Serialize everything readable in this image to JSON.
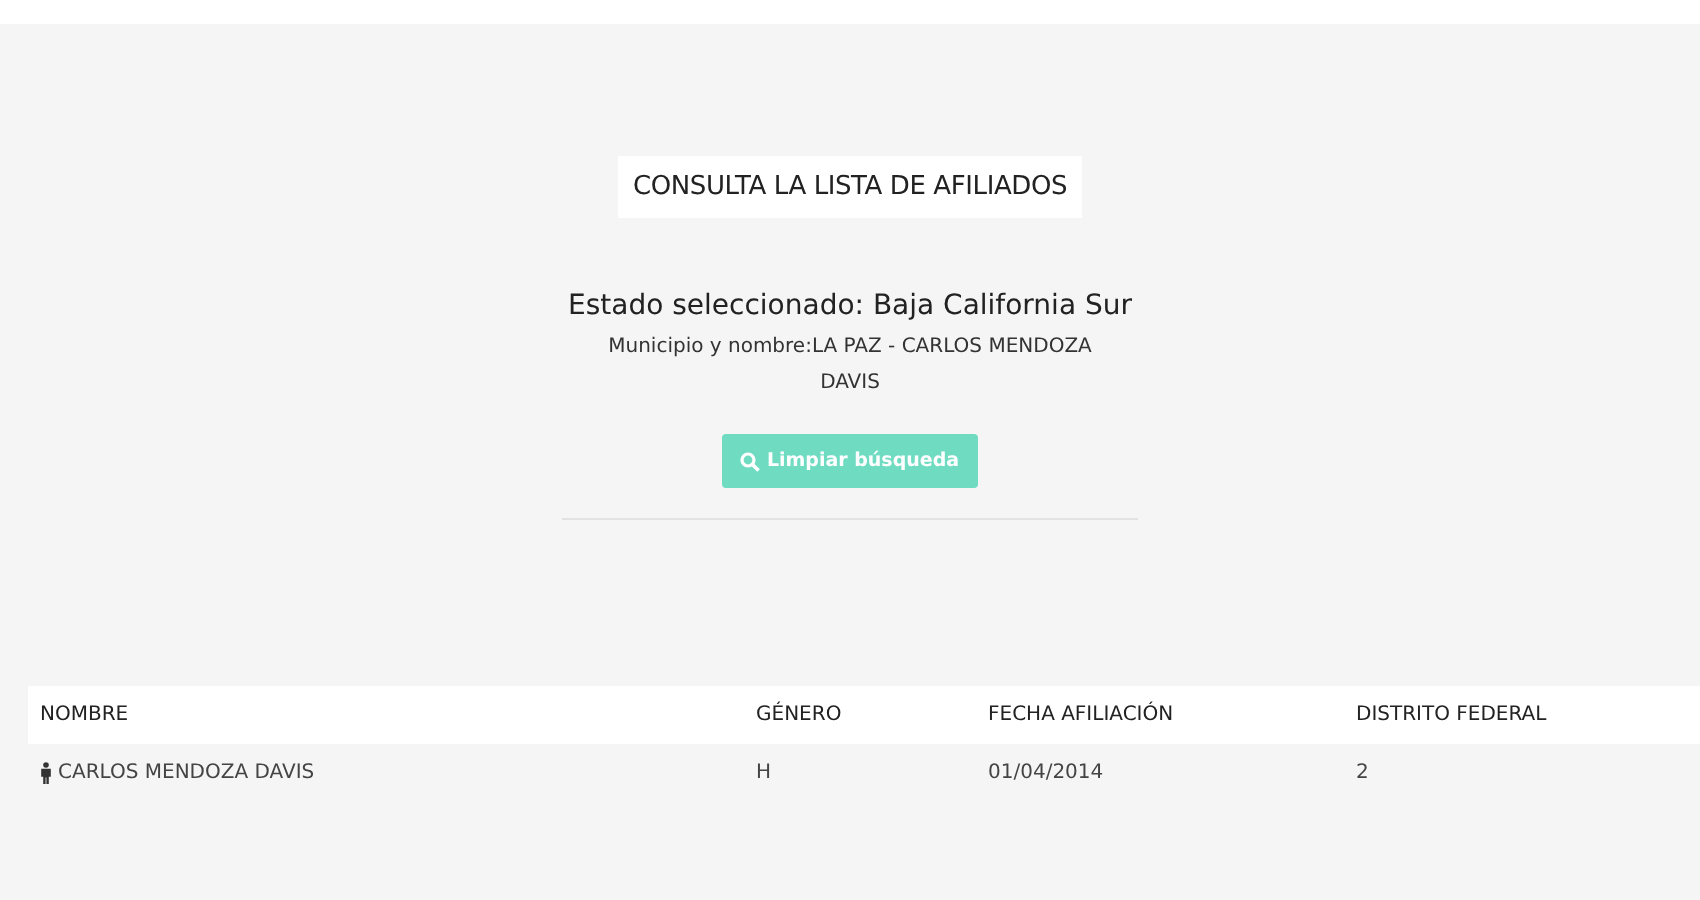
{
  "title": "CONSULTA LA LISTA DE AFILIADOS",
  "state_line": "Estado seleccionado: Baja California Sur",
  "filter_line": "Municipio y nombre:LA PAZ - CARLOS MENDOZA DAVIS",
  "clear_button": {
    "label": "Limpiar búsqueda",
    "disabled": true
  },
  "table": {
    "columns": [
      "NOMBRE",
      "GÉNERO",
      "FECHA AFILIACIÓN",
      "DISTRITO FEDERAL"
    ],
    "rows": [
      {
        "cells": [
          "CARLOS MENDOZA DAVIS",
          "H",
          "01/04/2014",
          "2"
        ]
      }
    ]
  }
}
